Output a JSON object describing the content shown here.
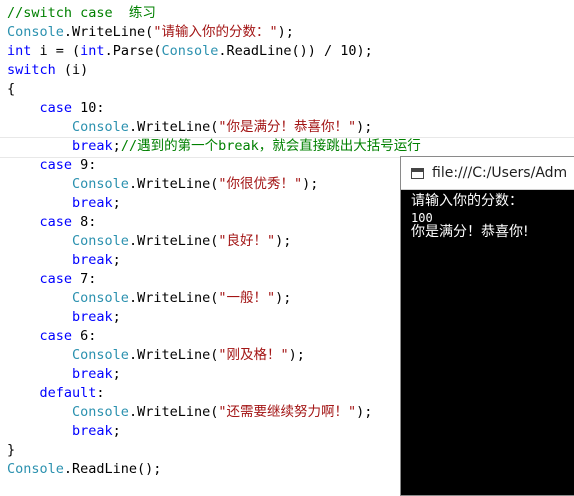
{
  "code": [
    {
      "segments": [
        {
          "t": "//switch case  练习",
          "c": "cm"
        }
      ]
    },
    {
      "segments": [
        {
          "t": "Console",
          "c": "cl"
        },
        {
          "t": ".WriteLine(",
          "c": "pl"
        },
        {
          "t": "\"请输入你的分数：\"",
          "c": "st"
        },
        {
          "t": ");",
          "c": "pl"
        }
      ]
    },
    {
      "segments": [
        {
          "t": "int",
          "c": "kw"
        },
        {
          "t": " i = (",
          "c": "pl"
        },
        {
          "t": "int",
          "c": "kw"
        },
        {
          "t": ".Parse(",
          "c": "pl"
        },
        {
          "t": "Console",
          "c": "cl"
        },
        {
          "t": ".ReadLine()) / 10);",
          "c": "pl"
        }
      ]
    },
    {
      "segments": [
        {
          "t": "switch",
          "c": "kw"
        },
        {
          "t": " (i)",
          "c": "pl"
        }
      ]
    },
    {
      "segments": [
        {
          "t": "{",
          "c": "pl"
        }
      ]
    },
    {
      "segments": [
        {
          "t": "    ",
          "c": "pl"
        },
        {
          "t": "case",
          "c": "kw"
        },
        {
          "t": " 10:",
          "c": "pl"
        }
      ]
    },
    {
      "segments": [
        {
          "t": "        ",
          "c": "pl"
        },
        {
          "t": "Console",
          "c": "cl"
        },
        {
          "t": ".WriteLine(",
          "c": "pl"
        },
        {
          "t": "\"你是满分！恭喜你！\"",
          "c": "st"
        },
        {
          "t": ");",
          "c": "pl"
        }
      ]
    },
    {
      "segments": [
        {
          "t": "        ",
          "c": "pl"
        },
        {
          "t": "break",
          "c": "kw"
        },
        {
          "t": ";",
          "c": "pl"
        },
        {
          "t": "//遇到的第一个break，就会直接跳出大括号运行",
          "c": "cm"
        }
      ]
    },
    {
      "segments": [
        {
          "t": "    ",
          "c": "pl"
        },
        {
          "t": "case",
          "c": "kw"
        },
        {
          "t": " 9:",
          "c": "pl"
        }
      ]
    },
    {
      "segments": [
        {
          "t": "        ",
          "c": "pl"
        },
        {
          "t": "Console",
          "c": "cl"
        },
        {
          "t": ".WriteLine(",
          "c": "pl"
        },
        {
          "t": "\"你很优秀！\"",
          "c": "st"
        },
        {
          "t": ");",
          "c": "pl"
        }
      ]
    },
    {
      "segments": [
        {
          "t": "        ",
          "c": "pl"
        },
        {
          "t": "break",
          "c": "kw"
        },
        {
          "t": ";",
          "c": "pl"
        }
      ]
    },
    {
      "segments": [
        {
          "t": "    ",
          "c": "pl"
        },
        {
          "t": "case",
          "c": "kw"
        },
        {
          "t": " 8:",
          "c": "pl"
        }
      ]
    },
    {
      "segments": [
        {
          "t": "        ",
          "c": "pl"
        },
        {
          "t": "Console",
          "c": "cl"
        },
        {
          "t": ".WriteLine(",
          "c": "pl"
        },
        {
          "t": "\"良好！\"",
          "c": "st"
        },
        {
          "t": ");",
          "c": "pl"
        }
      ]
    },
    {
      "segments": [
        {
          "t": "        ",
          "c": "pl"
        },
        {
          "t": "break",
          "c": "kw"
        },
        {
          "t": ";",
          "c": "pl"
        }
      ]
    },
    {
      "segments": [
        {
          "t": "    ",
          "c": "pl"
        },
        {
          "t": "case",
          "c": "kw"
        },
        {
          "t": " 7:",
          "c": "pl"
        }
      ]
    },
    {
      "segments": [
        {
          "t": "        ",
          "c": "pl"
        },
        {
          "t": "Console",
          "c": "cl"
        },
        {
          "t": ".WriteLine(",
          "c": "pl"
        },
        {
          "t": "\"一般！\"",
          "c": "st"
        },
        {
          "t": ");",
          "c": "pl"
        }
      ]
    },
    {
      "segments": [
        {
          "t": "        ",
          "c": "pl"
        },
        {
          "t": "break",
          "c": "kw"
        },
        {
          "t": ";",
          "c": "pl"
        }
      ]
    },
    {
      "segments": [
        {
          "t": "    ",
          "c": "pl"
        },
        {
          "t": "case",
          "c": "kw"
        },
        {
          "t": " 6:",
          "c": "pl"
        }
      ]
    },
    {
      "segments": [
        {
          "t": "        ",
          "c": "pl"
        },
        {
          "t": "Console",
          "c": "cl"
        },
        {
          "t": ".WriteLine(",
          "c": "pl"
        },
        {
          "t": "\"刚及格！\"",
          "c": "st"
        },
        {
          "t": ");",
          "c": "pl"
        }
      ]
    },
    {
      "segments": [
        {
          "t": "        ",
          "c": "pl"
        },
        {
          "t": "break",
          "c": "kw"
        },
        {
          "t": ";",
          "c": "pl"
        }
      ]
    },
    {
      "segments": [
        {
          "t": "    ",
          "c": "pl"
        },
        {
          "t": "default",
          "c": "kw"
        },
        {
          "t": ":",
          "c": "pl"
        }
      ]
    },
    {
      "segments": [
        {
          "t": "        ",
          "c": "pl"
        },
        {
          "t": "Console",
          "c": "cl"
        },
        {
          "t": ".WriteLine(",
          "c": "pl"
        },
        {
          "t": "\"还需要继续努力啊！\"",
          "c": "st"
        },
        {
          "t": ");",
          "c": "pl"
        }
      ]
    },
    {
      "segments": [
        {
          "t": "        ",
          "c": "pl"
        },
        {
          "t": "break",
          "c": "kw"
        },
        {
          "t": ";",
          "c": "pl"
        }
      ]
    },
    {
      "segments": [
        {
          "t": "}",
          "c": "pl"
        }
      ]
    },
    {
      "segments": [
        {
          "t": "Console",
          "c": "cl"
        },
        {
          "t": ".ReadLine();",
          "c": "pl"
        }
      ]
    }
  ],
  "console": {
    "title": "file:///C:/Users/Adm",
    "title_icon": "console-window-icon",
    "output": [
      "请输入你的分数：",
      "100",
      "你是满分！恭喜你!"
    ]
  },
  "colors": {
    "keyword": "#0000ff",
    "comment": "#008000",
    "class": "#2b91af",
    "string": "#a31515",
    "console_bg": "#000000"
  }
}
